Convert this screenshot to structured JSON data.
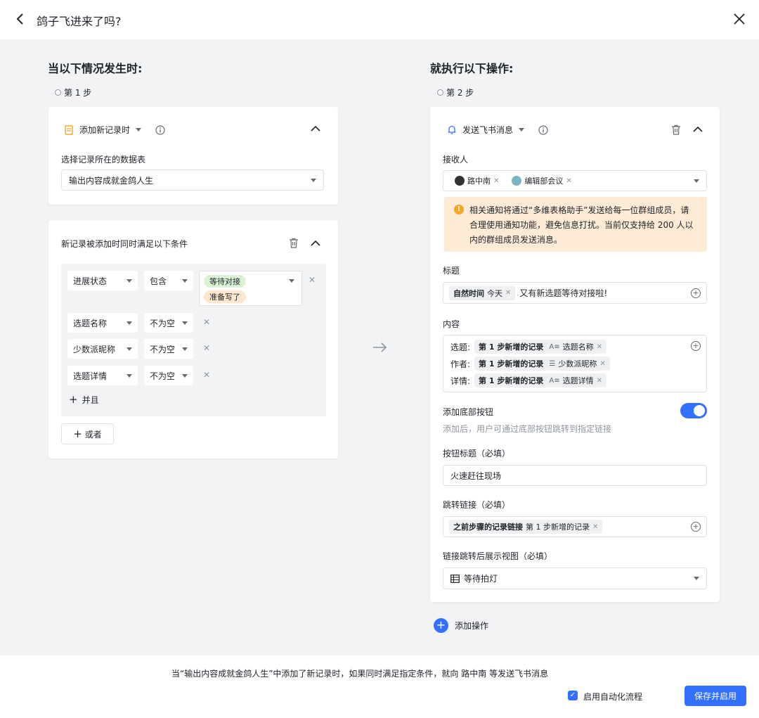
{
  "header": {
    "title": "鸽子飞进来了吗?"
  },
  "left": {
    "section_title": "当以下情况发生时:",
    "step_label": "第 1 步",
    "trigger": {
      "name": "添加新记录时",
      "table_label": "选择记录所在的数据表",
      "table_value": "输出内容成就金鸽人生"
    },
    "conditions": {
      "title": "新记录被添加时同时满足以下条件",
      "rows": [
        {
          "field": "进展状态",
          "op": "包含",
          "tags": [
            "等待对接",
            "准备写了"
          ]
        },
        {
          "field": "选题名称",
          "op": "不为空"
        },
        {
          "field": "少数派昵称",
          "op": "不为空"
        },
        {
          "field": "选题详情",
          "op": "不为空"
        }
      ],
      "and_label": "并且",
      "or_label": "或者"
    }
  },
  "right": {
    "section_title": "就执行以下操作:",
    "step_label": "第 2 步",
    "action": {
      "name": "发送飞书消息",
      "recipients_label": "接收人",
      "recipients": [
        "路中南",
        "编辑部会议"
      ],
      "notice": "相关通知将通过“多维表格助手”发送给每一位群组成员，请合理使用通知功能，避免信息打扰。当前仅支持给 200 人以内的群组成员发送消息。",
      "title_label": "标题",
      "title_chip_bold": "自然时间",
      "title_chip_sub": "今天",
      "title_text": "又有新选题等待对接啦!",
      "content_label": "内容",
      "content_rows": [
        {
          "prefix": "选题:",
          "chip_bold": "第 1 步新增的记录",
          "chip_sub": "选题名称",
          "icon": "text-field-icon"
        },
        {
          "prefix": "作者:",
          "chip_bold": "第 1 步新增的记录",
          "chip_sub": "少数派昵称",
          "icon": "list-field-icon"
        },
        {
          "prefix": "详情:",
          "chip_bold": "第 1 步新增的记录",
          "chip_sub": "选题详情",
          "icon": "text-field-icon"
        }
      ],
      "bottom_button_label": "添加底部按钮",
      "bottom_button_hint": "添加后，用户可通过底部按钮跳转到指定链接",
      "button_title_label": "按钮标题（必填）",
      "button_title_value": "火速赶往现场",
      "link_label": "跳转链接（必填）",
      "link_chip_bold": "之前步骤的记录链接",
      "link_chip_sub": "第 1 步新增的记录",
      "view_label": "链接跳转后展示视图（必填）",
      "view_value": "等待拍灯"
    },
    "add_action_label": "添加操作"
  },
  "footer": {
    "summary": "当“输出内容成就金鸽人生”中添加了新记录时，如果同时满足指定条件，就向 路中南 等发送飞书消息",
    "enable_label": "启用自动化流程",
    "save_label": "保存并启用"
  },
  "colors": {
    "accent": "#3370ff",
    "tag_green": "#d9f5d6",
    "tag_orange": "#fee7cd",
    "warn_bg": "#fdebd6"
  }
}
